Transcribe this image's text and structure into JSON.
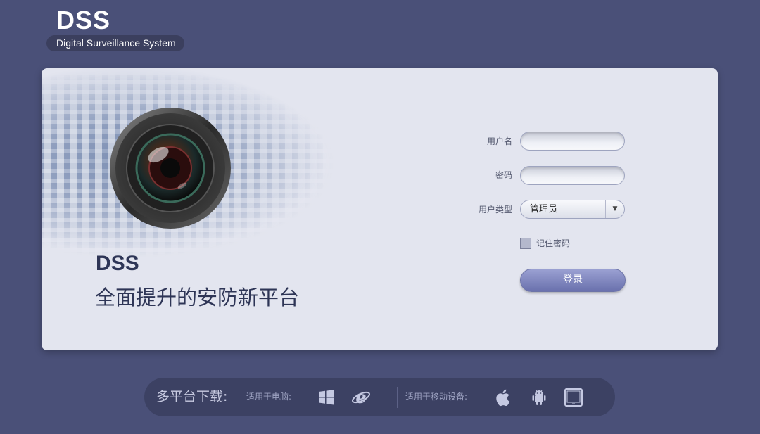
{
  "logo": {
    "mark": "DSS",
    "subtitle": "Digital Surveillance System"
  },
  "hero": {
    "title": "DSS",
    "subtitle": "全面提升的安防新平台"
  },
  "login": {
    "username_label": "用户名",
    "username_value": "",
    "password_label": "密码",
    "password_value": "",
    "user_type_label": "用户类型",
    "user_type_value": "管理员",
    "remember_label": "记住密码",
    "remember_checked": false,
    "submit_label": "登录"
  },
  "download_bar": {
    "title": "多平台下载:",
    "pc_label": "适用于电脑:",
    "mobile_label": "适用于移动设备:",
    "pc_icons": [
      "windows-icon",
      "internet-explorer-icon"
    ],
    "mobile_icons": [
      "apple-icon",
      "android-icon",
      "tablet-icon"
    ]
  },
  "colors": {
    "background": "#4a5078",
    "panel": "#e3e5ef",
    "button": "#7b82bd",
    "text_dark": "#2e3556"
  }
}
